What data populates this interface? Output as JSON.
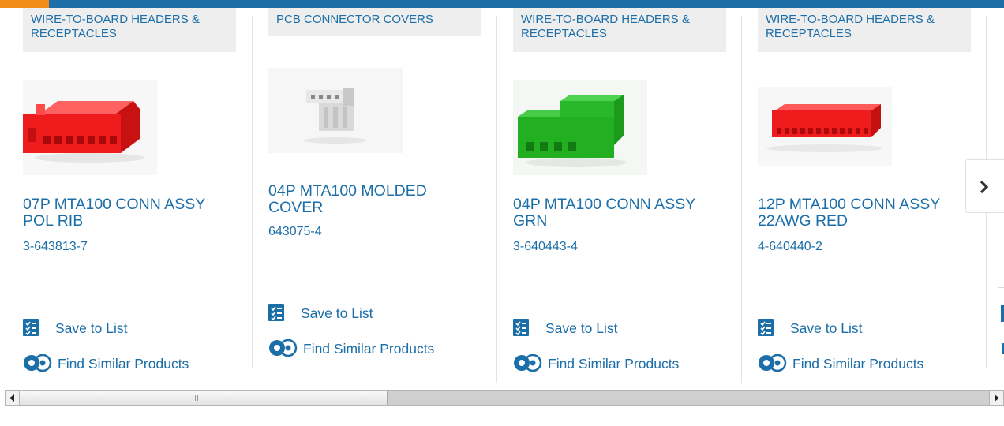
{
  "colors": {
    "brand_blue": "#1b6ea7",
    "accent_orange": "#f28d1a",
    "category_bg": "#eeeeee"
  },
  "products": [
    {
      "category": "WIRE-TO-BOARD HEADERS & RECEPTACLES",
      "title": "07P MTA100 CONN ASSY POL RIB",
      "part_number": "3-643813-7",
      "save_label": "Save to List",
      "find_label": "Find Similar Products",
      "image": "red-7-position-connector"
    },
    {
      "category": "PCB CONNECTOR COVERS",
      "title": "04P MTA100 MOLDED COVER",
      "part_number": "643075-4",
      "save_label": "Save to List",
      "find_label": "Find Similar Products",
      "image": "white-4-position-cover"
    },
    {
      "category": "WIRE-TO-BOARD HEADERS & RECEPTACLES",
      "title": "04P MTA100 CONN ASSY GRN",
      "part_number": "3-640443-4",
      "save_label": "Save to List",
      "find_label": "Find Similar Products",
      "image": "green-4-position-connector"
    },
    {
      "category": "WIRE-TO-BOARD HEADERS & RECEPTACLES",
      "title": "12P MTA100 CONN ASSY 22AWG RED",
      "part_number": "4-640440-2",
      "save_label": "Save to List",
      "find_label": "Find Similar Products",
      "image": "red-12-position-connector"
    }
  ],
  "carousel": {
    "next_icon": "chevron-right-icon"
  },
  "scrollbar": {
    "left_icon": "arrow-left-icon",
    "right_icon": "arrow-right-icon"
  }
}
